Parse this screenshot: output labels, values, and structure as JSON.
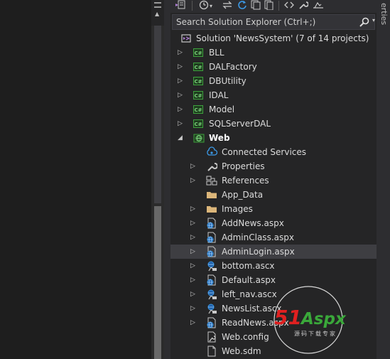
{
  "solution_explorer": {
    "search_placeholder": "Search Solution Explorer (Ctrl+;)",
    "side_tab_label": "erties",
    "tree": [
      {
        "label": "Solution 'NewsSystem' (7 of 14 projects)",
        "icon": "solution-icon",
        "level": 0
      },
      {
        "label": "BLL",
        "icon": "csharp-project-icon",
        "level": 1,
        "expander": "collapsed"
      },
      {
        "label": "DALFactory",
        "icon": "csharp-project-icon",
        "level": 1,
        "expander": "collapsed"
      },
      {
        "label": "DBUtility",
        "icon": "csharp-project-icon",
        "level": 1,
        "expander": "collapsed"
      },
      {
        "label": "IDAL",
        "icon": "csharp-project-icon",
        "level": 1,
        "expander": "collapsed"
      },
      {
        "label": "Model",
        "icon": "csharp-project-icon",
        "level": 1,
        "expander": "collapsed"
      },
      {
        "label": "SQLServerDAL",
        "icon": "csharp-project-icon",
        "level": 1,
        "expander": "collapsed"
      },
      {
        "label": "Web",
        "icon": "web-project-icon",
        "level": 1,
        "expander": "expanded",
        "bold": true
      },
      {
        "label": "Connected Services",
        "icon": "connected-services-icon",
        "level": 2
      },
      {
        "label": "Properties",
        "icon": "wrench-icon",
        "level": 2,
        "expander": "collapsed"
      },
      {
        "label": "References",
        "icon": "references-icon",
        "level": 2,
        "expander": "collapsed"
      },
      {
        "label": "App_Data",
        "icon": "folder-icon",
        "level": 2
      },
      {
        "label": "Images",
        "icon": "folder-icon",
        "level": 2,
        "expander": "collapsed"
      },
      {
        "label": "AddNews.aspx",
        "icon": "aspx-page-icon",
        "level": 2,
        "expander": "collapsed"
      },
      {
        "label": "AdminClass.aspx",
        "icon": "aspx-page-icon",
        "level": 2,
        "expander": "collapsed"
      },
      {
        "label": "AdminLogin.aspx",
        "icon": "aspx-page-icon",
        "level": 2,
        "expander": "collapsed",
        "selected": true
      },
      {
        "label": "bottom.ascx",
        "icon": "ascx-control-icon",
        "level": 2,
        "expander": "collapsed"
      },
      {
        "label": "Default.aspx",
        "icon": "aspx-page-icon",
        "level": 2,
        "expander": "collapsed"
      },
      {
        "label": "left_nav.ascx",
        "icon": "ascx-control-icon",
        "level": 2,
        "expander": "collapsed"
      },
      {
        "label": "NewsList.ascx",
        "icon": "ascx-control-icon",
        "level": 2,
        "expander": "collapsed"
      },
      {
        "label": "ReadNews.aspx",
        "icon": "aspx-page-icon",
        "level": 2,
        "expander": "collapsed"
      },
      {
        "label": "Web.config",
        "icon": "config-file-icon",
        "level": 2
      },
      {
        "label": "Web.sdm",
        "icon": "file-icon",
        "level": 2
      }
    ]
  },
  "watermark": {
    "brand": "51Aspx",
    "num": "51",
    "rest": "Aspx",
    "subtitle": "源码下载专家"
  },
  "colors": {
    "selection": "#3e3e42",
    "csharp_green": "#3ea13e",
    "web_blue": "#3c8ed8",
    "watermark_red": "#e02020",
    "watermark_green": "#3aa83a"
  }
}
